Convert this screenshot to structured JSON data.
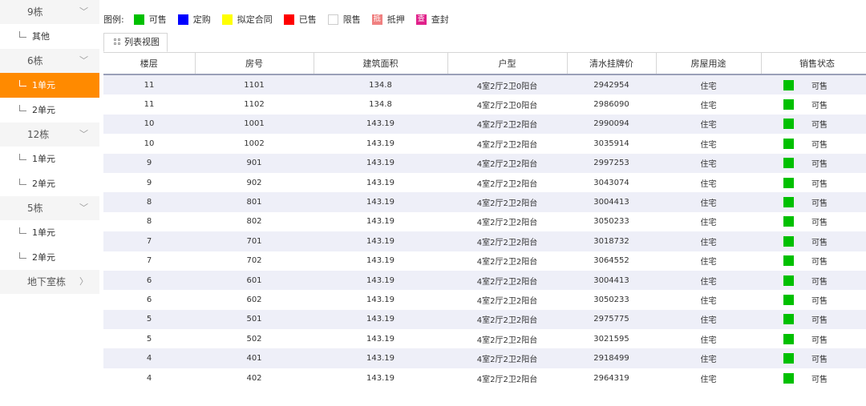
{
  "sidebar": {
    "groups": [
      {
        "label": "9栋",
        "items": [
          {
            "label": "其他"
          }
        ]
      },
      {
        "label": "6栋",
        "items": [
          {
            "label": "1单元"
          },
          {
            "label": "2单元"
          }
        ]
      },
      {
        "label": "12栋",
        "items": [
          {
            "label": "1单元"
          },
          {
            "label": "2单元"
          }
        ]
      },
      {
        "label": "5栋",
        "items": [
          {
            "label": "1单元"
          },
          {
            "label": "2单元"
          }
        ]
      },
      {
        "label": "地下室栋",
        "items": []
      }
    ],
    "active_item": "6栋-1单元"
  },
  "legend": {
    "title": "图例:",
    "items": [
      {
        "label": "可售",
        "color": "#00c000"
      },
      {
        "label": "定购",
        "color": "#0000ff"
      },
      {
        "label": "拟定合同",
        "color": "#ffff00"
      },
      {
        "label": "已售",
        "color": "#ff0000"
      },
      {
        "label": "限售",
        "color": "#ffffff"
      },
      {
        "label": "抵押",
        "color": "#f08080",
        "glyph": "抵"
      },
      {
        "label": "查封",
        "color": "#e0208a",
        "glyph": "查"
      }
    ]
  },
  "tab": {
    "label": "列表视图"
  },
  "table": {
    "columns": [
      "楼层",
      "房号",
      "建筑面积",
      "户型",
      "清水挂牌价",
      "房屋用途",
      "销售状态"
    ],
    "status_color": "#00c000",
    "rows": [
      {
        "floor": "11",
        "room": "1101",
        "area": "134.8",
        "layout": "4室2厅2卫0阳台",
        "price": "2942954",
        "use": "住宅",
        "status": "可售"
      },
      {
        "floor": "11",
        "room": "1102",
        "area": "134.8",
        "layout": "4室2厅2卫0阳台",
        "price": "2986090",
        "use": "住宅",
        "status": "可售"
      },
      {
        "floor": "10",
        "room": "1001",
        "area": "143.19",
        "layout": "4室2厅2卫2阳台",
        "price": "2990094",
        "use": "住宅",
        "status": "可售"
      },
      {
        "floor": "10",
        "room": "1002",
        "area": "143.19",
        "layout": "4室2厅2卫2阳台",
        "price": "3035914",
        "use": "住宅",
        "status": "可售"
      },
      {
        "floor": "9",
        "room": "901",
        "area": "143.19",
        "layout": "4室2厅2卫2阳台",
        "price": "2997253",
        "use": "住宅",
        "status": "可售"
      },
      {
        "floor": "9",
        "room": "902",
        "area": "143.19",
        "layout": "4室2厅2卫2阳台",
        "price": "3043074",
        "use": "住宅",
        "status": "可售"
      },
      {
        "floor": "8",
        "room": "801",
        "area": "143.19",
        "layout": "4室2厅2卫2阳台",
        "price": "3004413",
        "use": "住宅",
        "status": "可售"
      },
      {
        "floor": "8",
        "room": "802",
        "area": "143.19",
        "layout": "4室2厅2卫2阳台",
        "price": "3050233",
        "use": "住宅",
        "status": "可售"
      },
      {
        "floor": "7",
        "room": "701",
        "area": "143.19",
        "layout": "4室2厅2卫2阳台",
        "price": "3018732",
        "use": "住宅",
        "status": "可售"
      },
      {
        "floor": "7",
        "room": "702",
        "area": "143.19",
        "layout": "4室2厅2卫2阳台",
        "price": "3064552",
        "use": "住宅",
        "status": "可售"
      },
      {
        "floor": "6",
        "room": "601",
        "area": "143.19",
        "layout": "4室2厅2卫2阳台",
        "price": "3004413",
        "use": "住宅",
        "status": "可售"
      },
      {
        "floor": "6",
        "room": "602",
        "area": "143.19",
        "layout": "4室2厅2卫2阳台",
        "price": "3050233",
        "use": "住宅",
        "status": "可售"
      },
      {
        "floor": "5",
        "room": "501",
        "area": "143.19",
        "layout": "4室2厅2卫2阳台",
        "price": "2975775",
        "use": "住宅",
        "status": "可售"
      },
      {
        "floor": "5",
        "room": "502",
        "area": "143.19",
        "layout": "4室2厅2卫2阳台",
        "price": "3021595",
        "use": "住宅",
        "status": "可售"
      },
      {
        "floor": "4",
        "room": "401",
        "area": "143.19",
        "layout": "4室2厅2卫2阳台",
        "price": "2918499",
        "use": "住宅",
        "status": "可售"
      },
      {
        "floor": "4",
        "room": "402",
        "area": "143.19",
        "layout": "4室2厅2卫2阳台",
        "price": "2964319",
        "use": "住宅",
        "status": "可售"
      }
    ]
  }
}
